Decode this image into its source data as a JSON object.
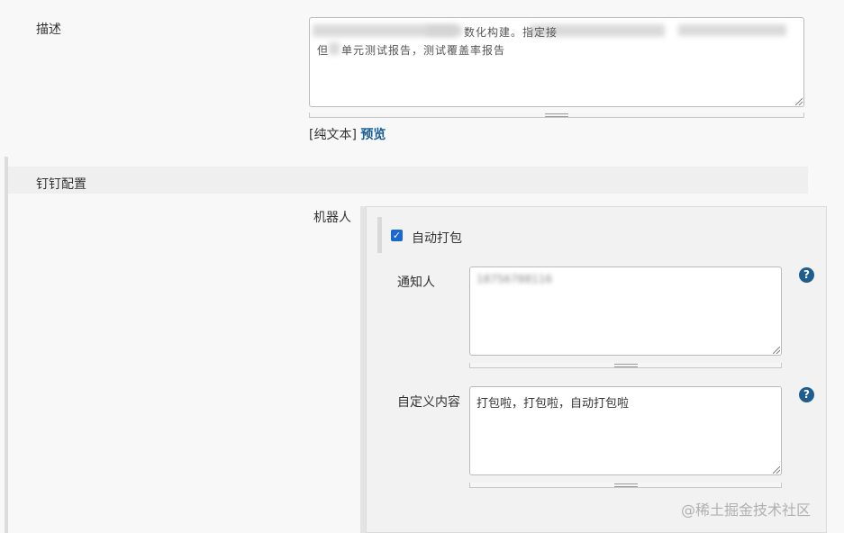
{
  "description": {
    "label": "描述",
    "text_visible_line1": "数化构建。指定接",
    "text_visible_line2_prefix": "但",
    "text_visible_line2": "单元测试报告，测试覆盖率报告",
    "plain_text_label": "[纯文本]",
    "preview_link": "预览"
  },
  "dingtalk": {
    "section_title": "钉钉配置",
    "robot_label": "机器人",
    "auto_package_label": "自动打包",
    "auto_package_checked": true,
    "notify_label": "通知人",
    "notify_value": "18756788116",
    "custom_label": "自定义内容",
    "custom_value": "打包啦，打包啦，自动打包啦",
    "help_glyph": "?"
  },
  "watermark": "@稀土掘金技术社区",
  "colors": {
    "accent": "#1a5e96",
    "checkbox": "#1967d2",
    "help_icon": "#1f5d8f"
  }
}
